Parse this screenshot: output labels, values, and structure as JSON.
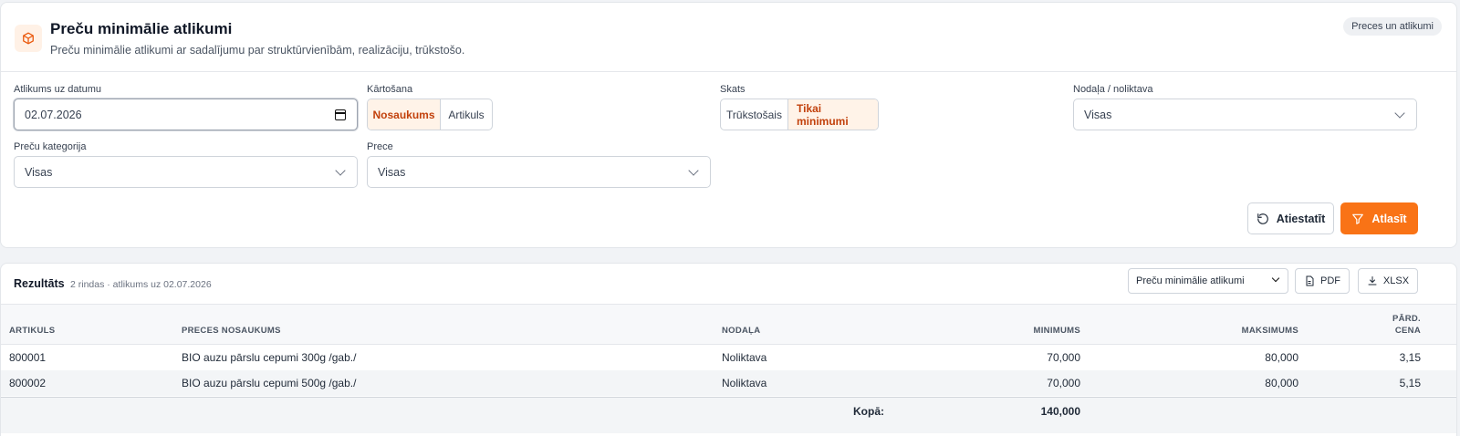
{
  "header": {
    "title": "Preču minimālie atlikumi",
    "subtitle": "Preču minimālie atlikumi ar sadalījumu par struktūrvienībām, realizāciju, trūkstošo.",
    "badge": "Preces un atlikumi",
    "icon": "box-icon"
  },
  "filters": {
    "date_label": "Atlikums uz datumu",
    "date_value": "02.07.2026",
    "sort_label": "Kārtošana",
    "sort_options": [
      "Nosaukums",
      "Artikuls"
    ],
    "sort_active": "Nosaukums",
    "view_label": "Skats",
    "view_options": [
      "Trūkstošais",
      "Tikai minimumi"
    ],
    "view_active": "Tikai minimumi",
    "dept_label": "Nodaļa / noliktava",
    "dept_value": "Visas",
    "category_label": "Preču kategorija",
    "category_value": "Visas",
    "product_label": "Prece",
    "product_value": "Visas",
    "reset_label": "Atiestatīt",
    "submit_label": "Atlasīt",
    "accent": "#f97316"
  },
  "results": {
    "title": "Rezultāts",
    "meta": "2 rindas · atlikums uz 02.07.2026",
    "report_select": "Preču minimālie atlikumi",
    "pdf_label": "PDF",
    "xlsx_label": "XLSX",
    "columns": {
      "article": "ARTIKULS",
      "name": "PRECES NOSAUKUMS",
      "dept": "NODAĻA",
      "min": "MINIMUMS",
      "max": "MAKSIMUMS",
      "price_1": "PĀRD.",
      "price_2": "CENA"
    },
    "rows": [
      {
        "article": "800001",
        "name": "BIO auzu pārslu cepumi 300g /gab./",
        "dept": "Noliktava",
        "min": "70,000",
        "max": "80,000",
        "price": "3,15"
      },
      {
        "article": "800002",
        "name": "BIO auzu pārslu cepumi 500g /gab./",
        "dept": "Noliktava",
        "min": "70,000",
        "max": "80,000",
        "price": "5,15"
      }
    ],
    "total_label": "Kopā:",
    "total_min": "140,000"
  }
}
